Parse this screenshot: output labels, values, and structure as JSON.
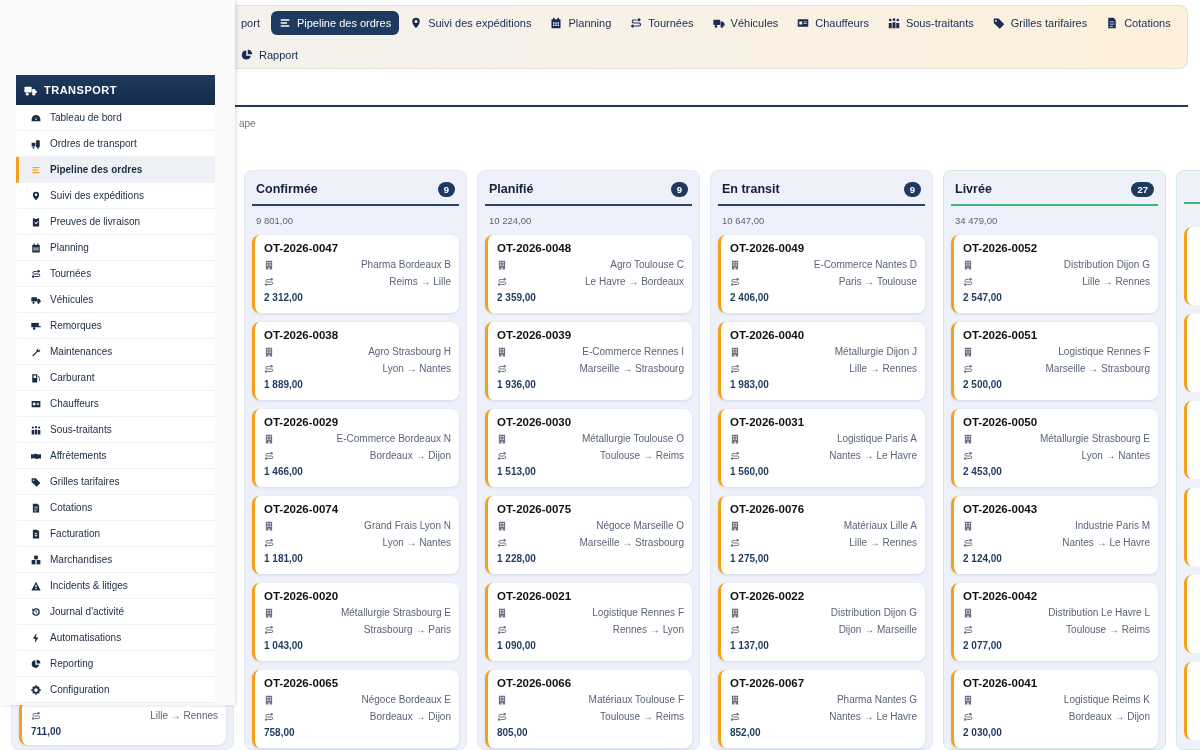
{
  "top_nav": {
    "tabs": [
      {
        "label": "port",
        "selected": false
      },
      {
        "label": "Pipeline des ordres",
        "selected": true
      },
      {
        "label": "Suivi des expéditions",
        "selected": false
      },
      {
        "label": "Planning",
        "selected": false
      },
      {
        "label": "Tournées",
        "selected": false
      },
      {
        "label": "Véhicules",
        "selected": false
      },
      {
        "label": "Chauffeurs",
        "selected": false
      },
      {
        "label": "Sous-traitants",
        "selected": false
      },
      {
        "label": "Grilles tarifaires",
        "selected": false
      },
      {
        "label": "Cotations",
        "selected": false
      },
      {
        "label": "Rapport",
        "selected": false
      }
    ]
  },
  "subtitle": "ape",
  "board": {
    "columns": [
      {
        "cards": [
          {
            "route": "Lille → Rennes",
            "amount": "711,00"
          }
        ]
      },
      {
        "title": "Confirmée",
        "count": "9",
        "total": "9 801,00",
        "color": "#2c4266",
        "cards": [
          {
            "id": "OT-2026-0047",
            "client": "Pharma Bordeaux B",
            "route": "Reims → Lille",
            "amount": "2 312,00"
          },
          {
            "id": "OT-2026-0038",
            "client": "Agro Strasbourg H",
            "route": "Lyon → Nantes",
            "amount": "1 889,00"
          },
          {
            "id": "OT-2026-0029",
            "client": "E-Commerce Bordeaux N",
            "route": "Bordeaux → Dijon",
            "amount": "1 466,00"
          },
          {
            "id": "OT-2026-0074",
            "client": "Grand Frais Lyon N",
            "route": "Lyon → Nantes",
            "amount": "1 181,00"
          },
          {
            "id": "OT-2026-0020",
            "client": "Métallurgie Strasbourg E",
            "route": "Strasbourg → Paris",
            "amount": "1 043,00"
          },
          {
            "id": "OT-2026-0065",
            "client": "Négoce Bordeaux E",
            "route": "Bordeaux → Dijon",
            "amount": "758,00"
          }
        ]
      },
      {
        "title": "Planifié",
        "count": "9",
        "total": "10 224,00",
        "color": "#2c4266",
        "cards": [
          {
            "id": "OT-2026-0048",
            "client": "Agro Toulouse C",
            "route": "Le Havre → Bordeaux",
            "amount": "2 359,00"
          },
          {
            "id": "OT-2026-0039",
            "client": "E-Commerce Rennes I",
            "route": "Marseille → Strasbourg",
            "amount": "1 936,00"
          },
          {
            "id": "OT-2026-0030",
            "client": "Métallurgie Toulouse O",
            "route": "Toulouse → Reims",
            "amount": "1 513,00"
          },
          {
            "id": "OT-2026-0075",
            "client": "Négoce Marseille O",
            "route": "Marseille → Strasbourg",
            "amount": "1 228,00"
          },
          {
            "id": "OT-2026-0021",
            "client": "Logistique Rennes F",
            "route": "Rennes → Lyon",
            "amount": "1 090,00"
          },
          {
            "id": "OT-2026-0066",
            "client": "Matériaux Toulouse F",
            "route": "Toulouse → Reims",
            "amount": "805,00"
          }
        ]
      },
      {
        "title": "En transit",
        "count": "9",
        "total": "10 647,00",
        "color": "#2c4266",
        "cards": [
          {
            "id": "OT-2026-0049",
            "client": "E-Commerce Nantes D",
            "route": "Paris → Toulouse",
            "amount": "2 406,00"
          },
          {
            "id": "OT-2026-0040",
            "client": "Métallurgie Dijon J",
            "route": "Lille → Rennes",
            "amount": "1 983,00"
          },
          {
            "id": "OT-2026-0031",
            "client": "Logistique Paris A",
            "route": "Nantes → Le Havre",
            "amount": "1 560,00"
          },
          {
            "id": "OT-2026-0076",
            "client": "Matériaux Lille A",
            "route": "Lille → Rennes",
            "amount": "1 275,00"
          },
          {
            "id": "OT-2026-0022",
            "client": "Distribution Dijon G",
            "route": "Dijon → Marseille",
            "amount": "1 137,00"
          },
          {
            "id": "OT-2026-0067",
            "client": "Pharma Nantes G",
            "route": "Nantes → Le Havre",
            "amount": "852,00"
          }
        ]
      },
      {
        "title": "Livrée",
        "count": "27",
        "total": "34 479,00",
        "color": "#3cb878",
        "cards": [
          {
            "id": "OT-2026-0052",
            "client": "Distribution Dijon G",
            "route": "Lille → Rennes",
            "amount": "2 547,00"
          },
          {
            "id": "OT-2026-0051",
            "client": "Logistique Rennes F",
            "route": "Marseille → Strasbourg",
            "amount": "2 500,00"
          },
          {
            "id": "OT-2026-0050",
            "client": "Métallurgie Strasbourg E",
            "route": "Lyon → Nantes",
            "amount": "2 453,00"
          },
          {
            "id": "OT-2026-0043",
            "client": "Industrie Paris M",
            "route": "Nantes → Le Havre",
            "amount": "2 124,00"
          },
          {
            "id": "OT-2026-0042",
            "client": "Distribution Le Havre L",
            "route": "Toulouse → Reims",
            "amount": "2 077,00"
          },
          {
            "id": "OT-2026-0041",
            "client": "Logistique Reims K",
            "route": "Bordeaux → Dijon",
            "amount": "2 030,00"
          }
        ]
      },
      {
        "color": "#3cb878"
      }
    ]
  },
  "menu": {
    "title": "TRANSPORT",
    "items": [
      {
        "label": "Tableau de bord",
        "selected": false
      },
      {
        "label": "Ordres de transport",
        "selected": false
      },
      {
        "label": "Pipeline des ordres",
        "selected": true
      },
      {
        "label": "Suivi des expéditions",
        "selected": false
      },
      {
        "label": "Preuves de livraison",
        "selected": false
      },
      {
        "label": "Planning",
        "selected": false
      },
      {
        "label": "Tournées",
        "selected": false
      },
      {
        "label": "Véhicules",
        "selected": false
      },
      {
        "label": "Remorques",
        "selected": false
      },
      {
        "label": "Maintenances",
        "selected": false
      },
      {
        "label": "Carburant",
        "selected": false
      },
      {
        "label": "Chauffeurs",
        "selected": false
      },
      {
        "label": "Sous-traitants",
        "selected": false
      },
      {
        "label": "Affrètements",
        "selected": false
      },
      {
        "label": "Grilles tarifaires",
        "selected": false
      },
      {
        "label": "Cotations",
        "selected": false
      },
      {
        "label": "Facturation",
        "selected": false
      },
      {
        "label": "Marchandises",
        "selected": false
      },
      {
        "label": "Incidents & litiges",
        "selected": false
      },
      {
        "label": "Journal d'activité",
        "selected": false
      },
      {
        "label": "Automatisations",
        "selected": false
      },
      {
        "label": "Reporting",
        "selected": false
      },
      {
        "label": "Configuration",
        "selected": false
      }
    ]
  }
}
